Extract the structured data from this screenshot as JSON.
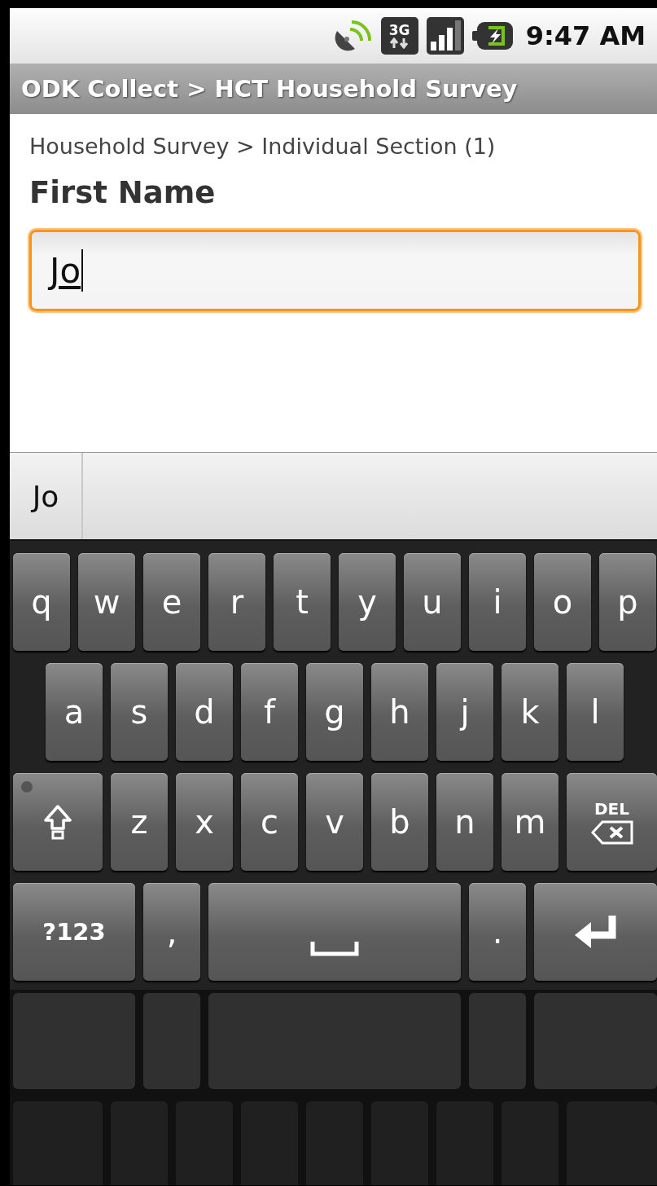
{
  "status_bar": {
    "time": "9:47 AM",
    "network": "3G"
  },
  "title_bar": {
    "title": "ODK Collect > HCT Household Survey"
  },
  "breadcrumb": "Household Survey > Individual Section (1)",
  "question": {
    "label": "First Name",
    "value": "Jo",
    "focused": true
  },
  "suggestions": [
    "Jo"
  ],
  "keyboard": {
    "rows": [
      [
        {
          "kind": "char",
          "label": "q"
        },
        {
          "kind": "char",
          "label": "w"
        },
        {
          "kind": "char",
          "label": "e"
        },
        {
          "kind": "char",
          "label": "r"
        },
        {
          "kind": "char",
          "label": "t"
        },
        {
          "kind": "char",
          "label": "y"
        },
        {
          "kind": "char",
          "label": "u"
        },
        {
          "kind": "char",
          "label": "i"
        },
        {
          "kind": "char",
          "label": "o"
        },
        {
          "kind": "char",
          "label": "p"
        }
      ],
      [
        {
          "kind": "char",
          "label": "a"
        },
        {
          "kind": "char",
          "label": "s"
        },
        {
          "kind": "char",
          "label": "d"
        },
        {
          "kind": "char",
          "label": "f"
        },
        {
          "kind": "char",
          "label": "g"
        },
        {
          "kind": "char",
          "label": "h"
        },
        {
          "kind": "char",
          "label": "j"
        },
        {
          "kind": "char",
          "label": "k"
        },
        {
          "kind": "char",
          "label": "l"
        }
      ],
      [
        {
          "kind": "shift"
        },
        {
          "kind": "char",
          "label": "z"
        },
        {
          "kind": "char",
          "label": "x"
        },
        {
          "kind": "char",
          "label": "c"
        },
        {
          "kind": "char",
          "label": "v"
        },
        {
          "kind": "char",
          "label": "b"
        },
        {
          "kind": "char",
          "label": "n"
        },
        {
          "kind": "char",
          "label": "m"
        },
        {
          "kind": "delete",
          "label": "DEL"
        }
      ],
      [
        {
          "kind": "symbols",
          "label": "?123"
        },
        {
          "kind": "char",
          "label": ","
        },
        {
          "kind": "space"
        },
        {
          "kind": "char",
          "label": "."
        },
        {
          "kind": "enter"
        }
      ]
    ]
  }
}
